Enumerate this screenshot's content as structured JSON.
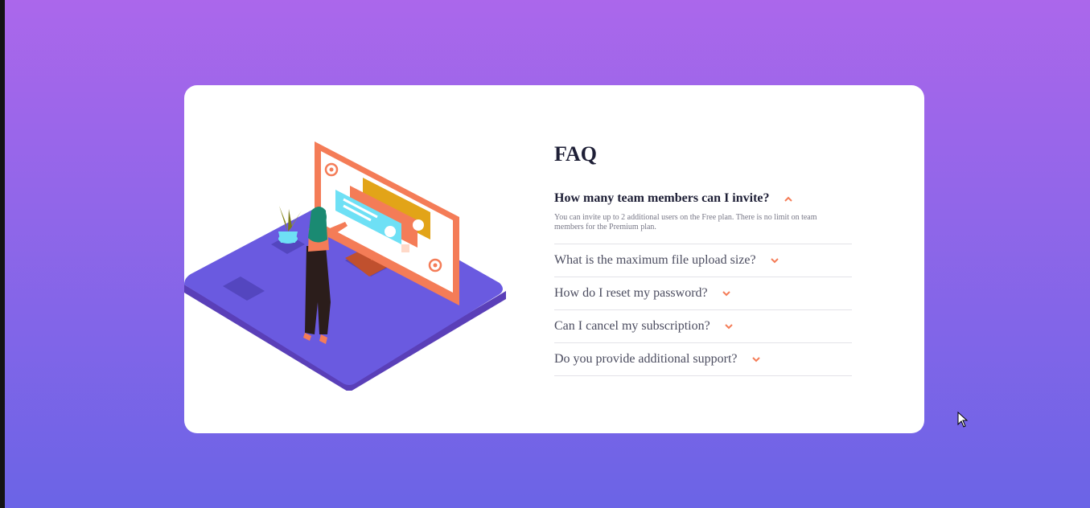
{
  "faq": {
    "title": "FAQ",
    "items": [
      {
        "question": "How many team members can I invite?",
        "answer": "You can invite up to 2 additional users on the Free plan. There is no limit on team members for the Premium plan.",
        "expanded": true
      },
      {
        "question": "What is the maximum file upload size?",
        "expanded": false
      },
      {
        "question": "How do I reset my password?",
        "expanded": false
      },
      {
        "question": "Can I cancel my subscription?",
        "expanded": false
      },
      {
        "question": "Do you provide additional support?",
        "expanded": false
      }
    ]
  },
  "colors": {
    "accent": "#f47c57",
    "heading": "#1e1f36",
    "text": "#4b4c5f",
    "divider": "#e3e2e8",
    "bg_top": "#ab67eb",
    "bg_bottom": "#6b64e6"
  },
  "icons": {
    "open": "chevron-up-icon",
    "closed": "chevron-down-icon"
  }
}
